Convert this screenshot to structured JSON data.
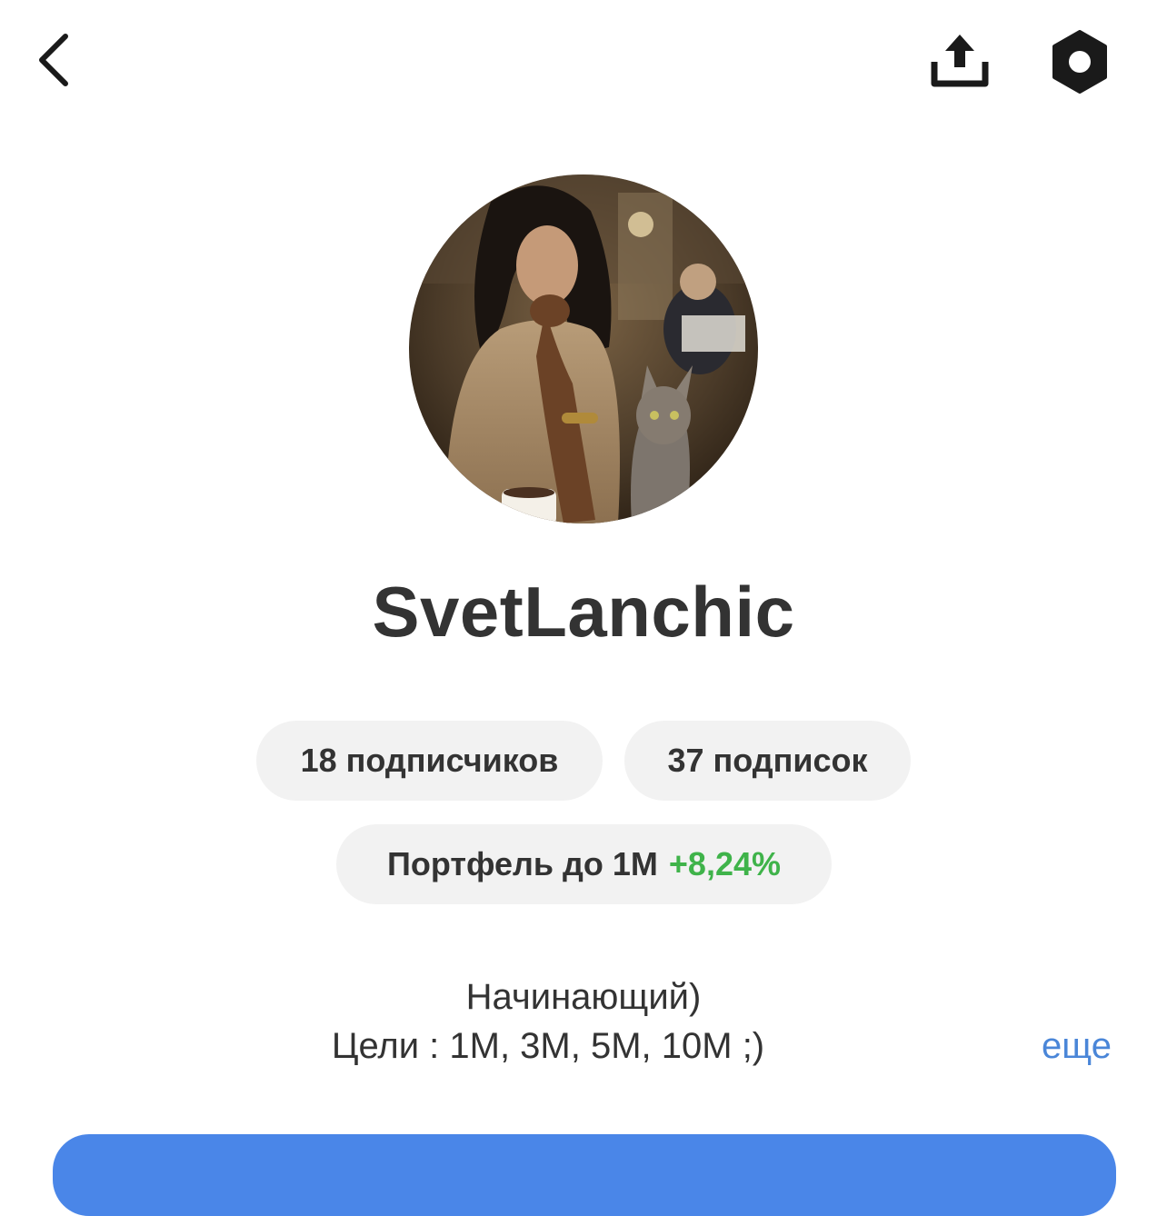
{
  "header": {
    "back_icon": "chevron-left-icon",
    "share_icon": "share-upload-icon",
    "settings_icon": "hexagon-settings-icon"
  },
  "profile": {
    "avatar_alt": "avatar photo",
    "username": "SvetLanchic"
  },
  "stats": {
    "followers": "18 подписчиков",
    "following": "37 подписок"
  },
  "portfolio": {
    "label": "Портфель до 1М",
    "change": "+8,24%",
    "change_color": "#3fb34a"
  },
  "bio": {
    "line1": "Начинающий)",
    "line2": "Цели : 1М, 3М, 5М, 10М ;)",
    "more_label": "еще"
  },
  "colors": {
    "accent": "#4a86e8",
    "link": "#4a86d8",
    "pill_bg": "#f2f2f2",
    "text": "#333333"
  }
}
